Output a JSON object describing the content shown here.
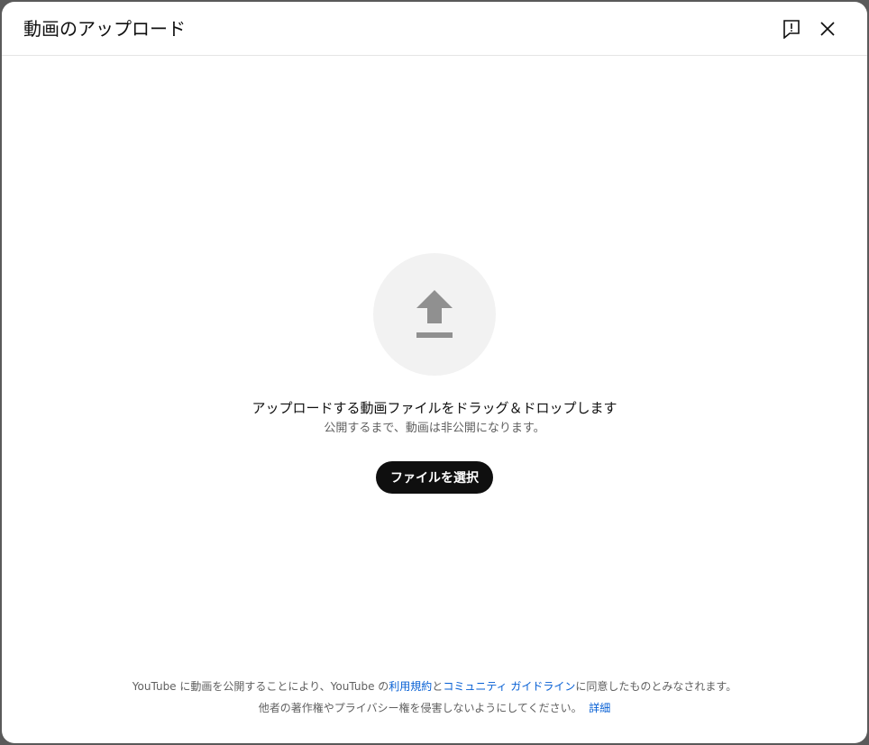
{
  "dialog": {
    "title": "動画のアップロード"
  },
  "header": {
    "feedback_icon": "feedback-icon",
    "close_icon": "close-icon"
  },
  "upload": {
    "icon": "upload-arrow-icon",
    "drop_title": "アップロードする動画ファイルをドラッグ＆ドロップします",
    "drop_subtitle": "公開するまで、動画は非公開になります。",
    "select_button_label": "ファイルを選択"
  },
  "footer": {
    "line1_prefix": "YouTube に動画を公開することにより、YouTube の",
    "terms_link": "利用規約",
    "line1_and": "と",
    "guidelines_link": "コミュニティ ガイドライン",
    "line1_suffix": "に同意したものとみなされます。",
    "line2_text": "他者の著作権やプライバシー権を侵害しないようにしてください。",
    "learn_more_link": "詳細"
  },
  "colors": {
    "accent_link": "#065fd4",
    "button_bg": "#0f0f0f",
    "upload_circle_bg": "#f2f2f2",
    "upload_icon": "#909090"
  }
}
